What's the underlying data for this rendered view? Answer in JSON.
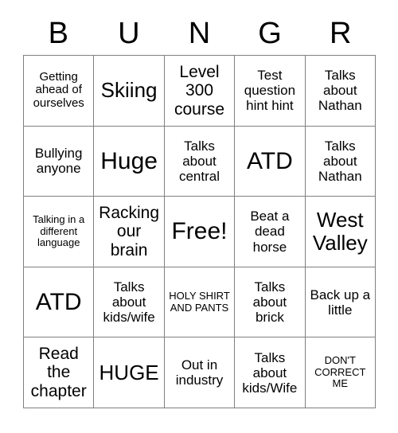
{
  "card": {
    "header_letters": [
      "B",
      "U",
      "N",
      "G",
      "R"
    ],
    "columns": 5,
    "rows": 5,
    "grid_line_color": "#808080",
    "background_color": "#ffffff",
    "text_color": "#000000",
    "cells": [
      {
        "text": "Getting ahead of ourselves",
        "size": "s"
      },
      {
        "text": "Skiing",
        "size": "xl"
      },
      {
        "text": "Level 300 course",
        "size": "l"
      },
      {
        "text": "Test question hint hint",
        "size": "m"
      },
      {
        "text": "Talks about Nathan",
        "size": "m"
      },
      {
        "text": "Bullying anyone",
        "size": "m"
      },
      {
        "text": "Huge",
        "size": "xxl"
      },
      {
        "text": "Talks about central",
        "size": "m"
      },
      {
        "text": "ATD",
        "size": "xxl"
      },
      {
        "text": "Talks about Nathan",
        "size": "m"
      },
      {
        "text": "Talking in a different language",
        "size": "xs"
      },
      {
        "text": "Racking our brain",
        "size": "l"
      },
      {
        "text": "Free!",
        "size": "xxl"
      },
      {
        "text": "Beat a dead horse",
        "size": "m"
      },
      {
        "text": "West Valley",
        "size": "xl"
      },
      {
        "text": "ATD",
        "size": "xxl"
      },
      {
        "text": "Talks about kids/wife",
        "size": "m"
      },
      {
        "text": "HOLY SHIRT AND PANTS",
        "size": "xs"
      },
      {
        "text": "Talks about brick",
        "size": "m"
      },
      {
        "text": "Back up a little",
        "size": "m"
      },
      {
        "text": "Read the chapter",
        "size": "l"
      },
      {
        "text": "HUGE",
        "size": "xl"
      },
      {
        "text": "Out in industry",
        "size": "m"
      },
      {
        "text": "Talks about kids/Wife",
        "size": "m"
      },
      {
        "text": "DON'T CORRECT ME",
        "size": "xs"
      }
    ]
  }
}
